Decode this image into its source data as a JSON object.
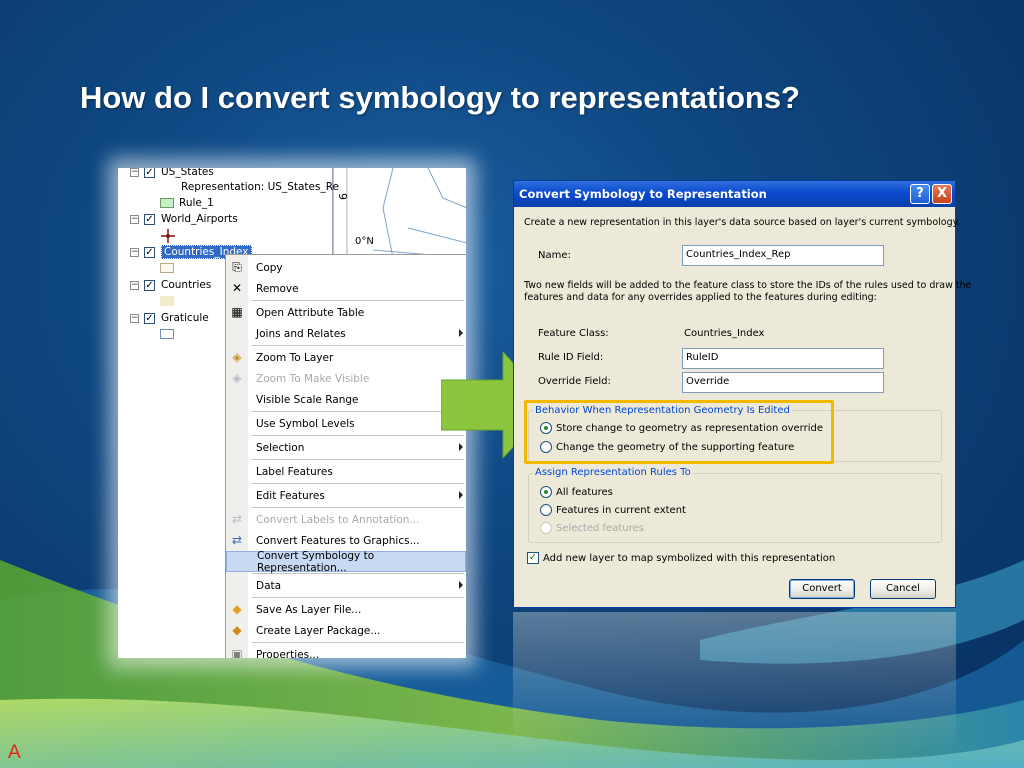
{
  "slide": {
    "title": "How do I convert symbology to representations?",
    "corner_mark": "A"
  },
  "toc": {
    "rows": [
      {
        "name": "US_States"
      },
      {
        "name": "Representation: US_States_Re"
      },
      {
        "name": "Rule_1"
      },
      {
        "name": "World_Airports"
      },
      {
        "name": "Countries_Index"
      },
      {
        "name": "Countries"
      },
      {
        "name": "Graticule"
      }
    ],
    "map_labels": [
      "6",
      "0°N"
    ]
  },
  "context_menu": {
    "items": [
      {
        "label": "Copy",
        "icon": "copy-icon",
        "disabled": false,
        "submenu": false
      },
      {
        "label": "Remove",
        "icon": "remove-icon",
        "disabled": false,
        "submenu": false
      },
      {
        "label": "Open Attribute Table",
        "icon": "table-icon",
        "disabled": false,
        "submenu": false
      },
      {
        "label": "Joins and Relates",
        "icon": "",
        "disabled": false,
        "submenu": true
      },
      {
        "label": "Zoom To Layer",
        "icon": "zoom-layer-icon",
        "disabled": false,
        "submenu": false
      },
      {
        "label": "Zoom To Make Visible",
        "icon": "zoom-visible-icon",
        "disabled": true,
        "submenu": false
      },
      {
        "label": "Visible Scale Range",
        "icon": "",
        "disabled": false,
        "submenu": true
      },
      {
        "label": "Use Symbol Levels",
        "icon": "",
        "disabled": false,
        "submenu": false
      },
      {
        "label": "Selection",
        "icon": "",
        "disabled": false,
        "submenu": true
      },
      {
        "label": "Label Features",
        "icon": "",
        "disabled": false,
        "submenu": false
      },
      {
        "label": "Edit Features",
        "icon": "",
        "disabled": false,
        "submenu": true
      },
      {
        "label": "Convert Labels to Annotation...",
        "icon": "convert-labels-icon",
        "disabled": true,
        "submenu": false
      },
      {
        "label": "Convert Features to Graphics...",
        "icon": "convert-graphics-icon",
        "disabled": false,
        "submenu": false
      },
      {
        "label": "Convert Symbology to Representation...",
        "icon": "",
        "disabled": false,
        "submenu": false,
        "highlighted": true
      },
      {
        "label": "Data",
        "icon": "",
        "disabled": false,
        "submenu": true
      },
      {
        "label": "Save As Layer File...",
        "icon": "save-layer-icon",
        "disabled": false,
        "submenu": false
      },
      {
        "label": "Create Layer Package...",
        "icon": "layer-package-icon",
        "disabled": false,
        "submenu": false
      },
      {
        "label": "Properties...",
        "icon": "properties-icon",
        "disabled": false,
        "submenu": false
      }
    ]
  },
  "dialog": {
    "title": "Convert Symbology to Representation",
    "help_label": "?",
    "close_label": "X",
    "intro": "Create a new representation in this layer's data source based on layer's current symbology.",
    "name_label": "Name:",
    "name_value": "Countries_Index_Rep",
    "fields_note_1": "Two new fields will be added to the feature class to store the IDs of the rules used to draw the",
    "fields_note_2": "features and data for any overrides applied to the features during editing:",
    "feature_class_label": "Feature Class:",
    "feature_class_value": "Countries_Index",
    "rule_id_label": "Rule ID Field:",
    "rule_id_value": "RuleID",
    "override_label": "Override Field:",
    "override_value": "Override",
    "behavior_group": "Behavior When Representation Geometry Is Edited",
    "behavior_opt1": "Store change to geometry as representation override",
    "behavior_opt2": "Change the geometry of the supporting feature",
    "behavior_selected": 1,
    "assign_group": "Assign Representation Rules To",
    "assign_opt1": "All features",
    "assign_opt2": "Features in current extent",
    "assign_opt3": "Selected features",
    "add_layer_label": "Add new layer to map symbolized with this representation",
    "add_layer_checked": true,
    "convert_label": "Convert",
    "cancel_label": "Cancel"
  },
  "colors": {
    "highlight_border": "#f5b800",
    "arrow_green": "#8cc63f",
    "title_bar": "#0b4ad0"
  }
}
